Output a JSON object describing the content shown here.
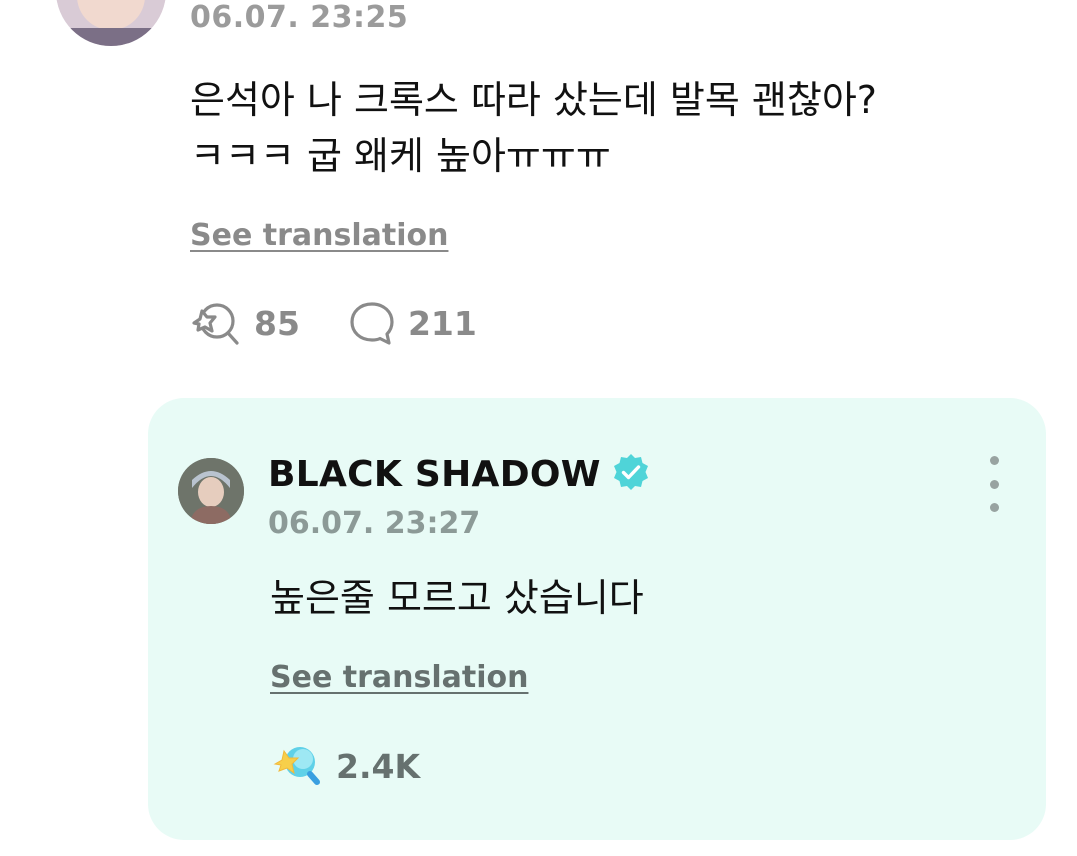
{
  "post": {
    "timestamp": "06.07. 23:25",
    "text_lines": [
      "은석아 나 크록스 따라 샀는데 발목 괜찮아?",
      "ㅋㅋㅋ 굽 왜케 높아ㅠㅠㅠ"
    ],
    "see_translation": "See translation",
    "likes_count": "85",
    "comments_count": "211",
    "like_icon": "like-outline-icon",
    "comment_icon": "comment-bubble-icon"
  },
  "reply": {
    "author_name": "BLACK SHADOW",
    "verified_icon": "verified-badge-icon",
    "timestamp": "06.07. 23:27",
    "text": "높은줄 모르고 샀습니다",
    "see_translation": "See translation",
    "likes_count": "2.4K",
    "like_icon": "like-filled-icon",
    "menu_icon": "more-vertical-icon"
  },
  "colors": {
    "card_background": "#e8fbf6",
    "verified_badge": "#4fd4d8",
    "muted_text": "#9b9b9b",
    "primary_text": "#111111"
  }
}
